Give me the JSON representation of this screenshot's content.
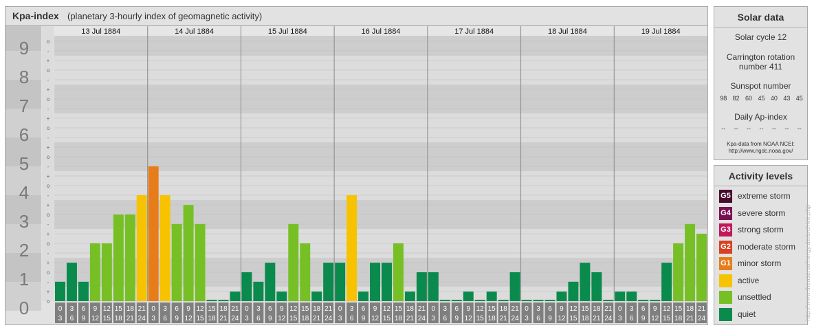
{
  "main": {
    "title": "Kpa-index",
    "subtitle": "(planetary 3-hourly index of geomagnetic activity)"
  },
  "chart_data": {
    "type": "bar",
    "title": "Kpa-index",
    "ylim": [
      0,
      9
    ],
    "y_ticks": [
      "0",
      "1",
      "2",
      "3",
      "4",
      "5",
      "6",
      "7",
      "8",
      "9"
    ],
    "subticks": [
      "-",
      "o",
      "+"
    ],
    "days": [
      "13 Jul 1884",
      "14 Jul 1884",
      "15 Jul 1884",
      "16 Jul 1884",
      "17 Jul 1884",
      "18 Jul 1884",
      "19 Jul 1884"
    ],
    "slot_top": [
      "0",
      "3",
      "6",
      "9",
      "12",
      "15",
      "18",
      "21"
    ],
    "slot_bottom": [
      "3",
      "6",
      "9",
      "12",
      "15",
      "18",
      "21",
      "24"
    ],
    "values": [
      [
        0.67,
        1.33,
        0.67,
        2.0,
        2.0,
        3.0,
        3.0,
        3.67
      ],
      [
        4.67,
        3.67,
        2.67,
        3.33,
        2.67,
        0,
        0,
        0.33
      ],
      [
        1.0,
        0.67,
        1.33,
        0.33,
        2.67,
        2.0,
        0.33,
        1.33
      ],
      [
        1.33,
        3.67,
        0.33,
        1.33,
        1.33,
        2.0,
        0.33,
        1.0
      ],
      [
        1.0,
        0,
        0,
        0.33,
        0,
        0.33,
        0,
        1.0
      ],
      [
        0,
        0,
        0,
        0.33,
        0.67,
        1.33,
        1.0,
        0
      ],
      [
        0.33,
        0.33,
        0,
        0,
        1.33,
        2.0,
        2.67,
        2.33
      ]
    ],
    "colors": {
      "quiet": "#0a8a4c",
      "unsettled": "#76c025",
      "active": "#f7c300",
      "minor": "#e77d1a",
      "moderate": "#d9411f",
      "strong": "#c2185b",
      "severe": "#7a1050",
      "extreme": "#4a0a2e"
    }
  },
  "solar": {
    "title": "Solar data",
    "cycle": "Solar cycle 12",
    "carrington_line1": "Carrington rotation",
    "carrington_line2": "number 411",
    "sunspot_label": "Sunspot number",
    "sunspot_values": [
      "98",
      "82",
      "60",
      "45",
      "40",
      "43",
      "45"
    ],
    "ap_label": "Daily Ap-index",
    "ap_values": [
      "--",
      "--",
      "--",
      "--",
      "--",
      "--",
      "--"
    ],
    "source_line1": "Kpa-data from NOAA NCEI:",
    "source_line2": "http://www.ngdc.noaa.gov/"
  },
  "activity": {
    "title": "Activity levels",
    "levels": [
      {
        "badge": "G5",
        "label": "extreme storm",
        "color": "#4a0a2e"
      },
      {
        "badge": "G4",
        "label": "severe storm",
        "color": "#7a1050"
      },
      {
        "badge": "G3",
        "label": "strong storm",
        "color": "#c2185b"
      },
      {
        "badge": "G2",
        "label": "moderate storm",
        "color": "#d9411f"
      },
      {
        "badge": "G1",
        "label": "minor storm",
        "color": "#e77d1a"
      },
      {
        "badge": "",
        "label": "active",
        "color": "#f7c300"
      },
      {
        "badge": "",
        "label": "unsettled",
        "color": "#76c025"
      },
      {
        "badge": "",
        "label": "quiet",
        "color": "#0a8a4c"
      }
    ]
  },
  "watermark": "http://www.theusersofnergy.de/archive.php"
}
